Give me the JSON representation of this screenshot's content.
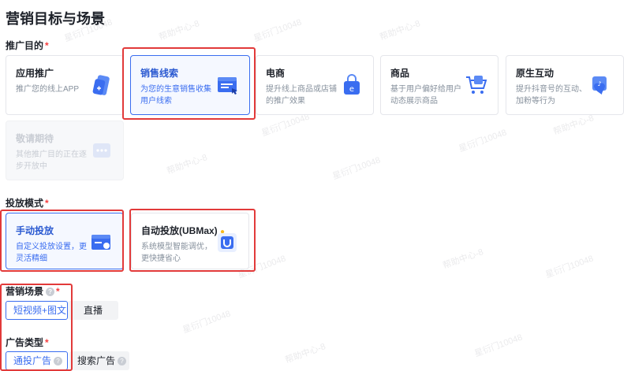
{
  "page_title": "营销目标与场景",
  "goal_section": {
    "label": "推广目的",
    "required_mark": "*"
  },
  "goal_cards": [
    {
      "title": "应用推广",
      "desc1": "推广您的线上APP",
      "desc2": "",
      "icon": "phone-plus-icon"
    },
    {
      "title": "销售线索",
      "desc1": "为您的生意销售收集",
      "desc2": "用户线索",
      "icon": "form-cursor-icon"
    },
    {
      "title": "电商",
      "desc1": "提升线上商品或店铺",
      "desc2": "的推广效果",
      "icon": "shopping-bag-icon"
    },
    {
      "title": "商品",
      "desc1": "基于用户偏好给用户",
      "desc2": "动态展示商品",
      "icon": "shopping-cart-icon"
    },
    {
      "title": "原生互动",
      "desc1": "提升抖音号的互动、",
      "desc2": "加粉等行为",
      "icon": "douyin-heart-icon"
    },
    {
      "title": "敬请期待",
      "desc1": "其他推广目的正在逐",
      "desc2": "步开放中",
      "icon": "more-dots-icon"
    }
  ],
  "mode_section": {
    "label": "投放模式",
    "required_mark": "*"
  },
  "mode_cards": [
    {
      "title": "手动投放",
      "desc1": "自定义投放设置，更",
      "desc2": "灵活精细",
      "icon": "manual-window-icon"
    },
    {
      "title": "自动投放(UBMax)",
      "desc1": "系统模型智能调优，",
      "desc2": "更快捷省心",
      "icon": "auto-robot-icon"
    }
  ],
  "scene_section": {
    "label": "营销场景",
    "required_mark": "*",
    "options": [
      "短视频+图文",
      "直播"
    ]
  },
  "adtype_section": {
    "label": "广告类型",
    "required_mark": "*",
    "options": [
      "通投广告",
      "搜索广告"
    ]
  },
  "watermark_lines": [
    "帮助中心-8",
    "星衍门10048"
  ],
  "colors": {
    "accent": "#3a6df0",
    "highlight_box": "#e23a3a",
    "required": "#f53f3f"
  }
}
